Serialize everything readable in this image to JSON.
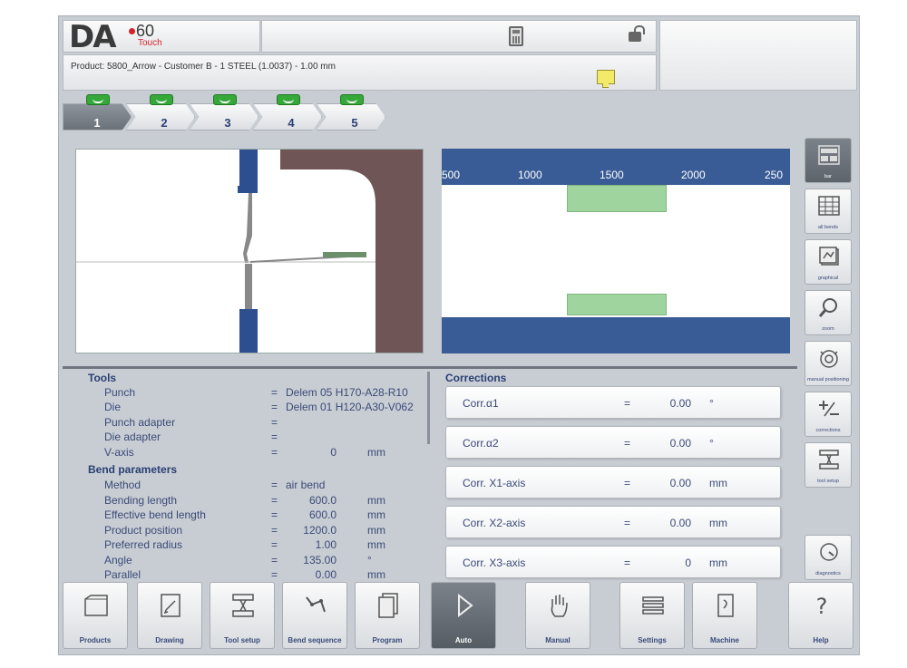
{
  "header": {
    "logo_da": "DA",
    "logo_model": "60",
    "logo_sub": "Touch",
    "product_line": "Product: 5800_Arrow - Customer B - 1 STEEL (1.0037) - 1.00 mm"
  },
  "bend_tabs": [
    {
      "label": "1",
      "active": true
    },
    {
      "label": "2",
      "active": false
    },
    {
      "label": "3",
      "active": false
    },
    {
      "label": "4",
      "active": false
    },
    {
      "label": "5",
      "active": false
    }
  ],
  "front_view_axis": [
    "500",
    "1000",
    "1500",
    "2000",
    "250"
  ],
  "tools": {
    "title": "Tools",
    "rows": [
      {
        "key": "Punch",
        "value": "Delem 05 H170-A28-R10",
        "unit": ""
      },
      {
        "key": "Die",
        "value": "Delem 01 H120-A30-V062",
        "unit": ""
      },
      {
        "key": "Punch adapter",
        "value": "",
        "unit": ""
      },
      {
        "key": "Die adapter",
        "value": "",
        "unit": ""
      },
      {
        "key": "V-axis",
        "value": "0",
        "unit": "mm"
      }
    ]
  },
  "bend_parameters": {
    "title": "Bend parameters",
    "rows": [
      {
        "key": "Method",
        "value": "air bend",
        "unit": ""
      },
      {
        "key": "Bending length",
        "value": "600.0",
        "unit": "mm"
      },
      {
        "key": "Effective bend length",
        "value": "600.0",
        "unit": "mm"
      },
      {
        "key": "Product position",
        "value": "1200.0",
        "unit": "mm"
      },
      {
        "key": "Preferred radius",
        "value": "1.00",
        "unit": "mm"
      },
      {
        "key": "Angle",
        "value": "135.00",
        "unit": "°"
      },
      {
        "key": "Parallel",
        "value": "0.00",
        "unit": "mm"
      }
    ]
  },
  "corrections": {
    "title": "Corrections",
    "rows": [
      {
        "key": "Corr.α1",
        "value": "0.00",
        "unit": "°"
      },
      {
        "key": "Corr.α2",
        "value": "0.00",
        "unit": "°"
      },
      {
        "key": "Corr. X1-axis",
        "value": "0.00",
        "unit": "mm"
      },
      {
        "key": "Corr. X2-axis",
        "value": "0.00",
        "unit": "mm"
      },
      {
        "key": "Corr. X3-axis",
        "value": "0",
        "unit": "mm"
      }
    ]
  },
  "right_tools": [
    {
      "label": "bar",
      "active": true
    },
    {
      "label": "all bends",
      "active": false
    },
    {
      "label": "graphical",
      "active": false
    },
    {
      "label": "zoom",
      "active": false
    },
    {
      "label": "manual positioning",
      "active": false
    },
    {
      "label": "corrections",
      "active": false
    },
    {
      "label": "tool setup",
      "active": false
    },
    {
      "label": "diagnostics",
      "active": false
    }
  ],
  "nav": [
    {
      "label": "Products",
      "active": false
    },
    {
      "label": "Drawing",
      "active": false
    },
    {
      "label": "Tool setup",
      "active": false
    },
    {
      "label": "Bend sequence",
      "active": false
    },
    {
      "label": "Program",
      "active": false
    },
    {
      "label": "Auto",
      "active": true
    },
    {
      "label": "Manual",
      "active": false
    },
    {
      "label": "Settings",
      "active": false
    },
    {
      "label": "Machine",
      "active": false
    },
    {
      "label": "Help",
      "active": false
    }
  ]
}
